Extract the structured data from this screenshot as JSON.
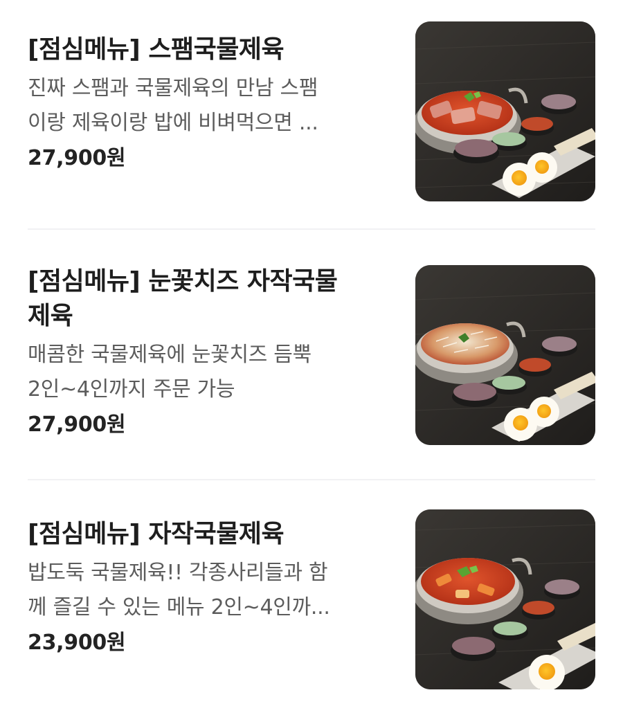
{
  "menu": {
    "items": [
      {
        "title_lines": [
          "[점심메뉴] 스팸국물제육"
        ],
        "desc_lines": [
          "진짜 스팸과 국물제육의 만남 스팸",
          "이랑 제육이랑 밥에 비벼먹으면 ..."
        ],
        "price": "27,900원",
        "image_icon": "spam-stew-photo"
      },
      {
        "title_lines": [
          "[점심메뉴] 눈꽃치즈 자작국물",
          "제육"
        ],
        "desc_lines": [
          "매콤한 국물제육에 눈꽃치즈 듬뿍",
          "2인~4인까지 주문 가능"
        ],
        "price": "27,900원",
        "image_icon": "cheese-stew-photo"
      },
      {
        "title_lines": [
          "[점심메뉴] 자작국물제육"
        ],
        "desc_lines": [
          "밥도둑 국물제육!! 각종사리들과 함",
          "께 즐길 수 있는 메뉴 2인~4인까..."
        ],
        "price": "23,900원",
        "image_icon": "pork-stew-photo"
      }
    ]
  },
  "colors": {
    "title": "#1e1e1e",
    "description": "#5c5c5c",
    "price": "#232323",
    "divider": "#f1f1f3",
    "photo_background": "#2d2b28"
  }
}
